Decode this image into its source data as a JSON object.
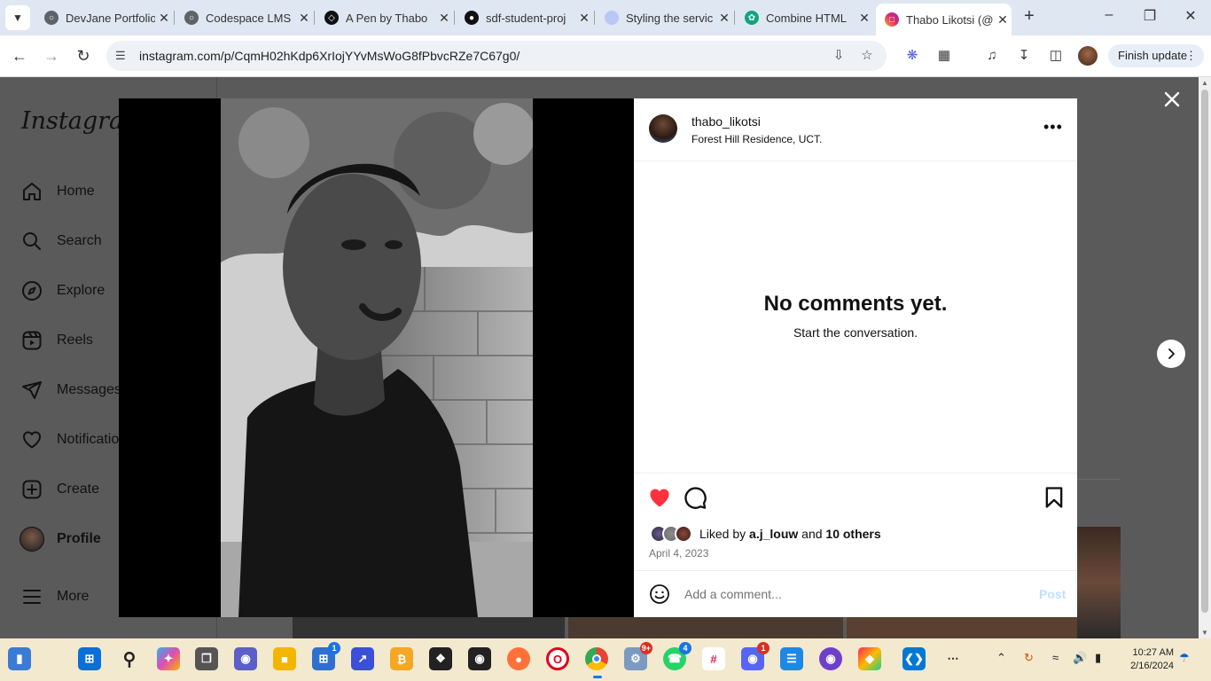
{
  "browser": {
    "tabs": [
      {
        "title": "DevJane Portfolio",
        "fav_color": "#5f6368",
        "active": false
      },
      {
        "title": "Codespace LMS",
        "fav_color": "#5f6368",
        "active": false
      },
      {
        "title": "A Pen by Thabo",
        "fav_color": "#111111",
        "active": false
      },
      {
        "title": "sdf-student-proj",
        "fav_color": "#111111",
        "active": false
      },
      {
        "title": "Styling the servic",
        "fav_color": "#b9c7f5",
        "active": false
      },
      {
        "title": "Combine HTML",
        "fav_color": "#10a37f",
        "active": false
      },
      {
        "title": "Thabo Likotsi (@",
        "fav_color": "#e1306c",
        "active": true
      }
    ],
    "url": "instagram.com/p/CqmH02hKdp6XrIojYYvMsWoG8fPbvcRZe7C67g0/",
    "finish_update_label": "Finish update",
    "new_tab_label": "+"
  },
  "instagram": {
    "logo_text": "Instagram",
    "nav": [
      {
        "label": "Home",
        "icon": "home-icon"
      },
      {
        "label": "Search",
        "icon": "search-icon"
      },
      {
        "label": "Explore",
        "icon": "explore-icon"
      },
      {
        "label": "Reels",
        "icon": "reels-icon"
      },
      {
        "label": "Messages",
        "icon": "messages-icon"
      },
      {
        "label": "Notifications",
        "icon": "heart-icon"
      },
      {
        "label": "Create",
        "icon": "create-icon"
      },
      {
        "label": "Profile",
        "icon": "avatar"
      },
      {
        "label": "More",
        "icon": "menu-icon"
      }
    ],
    "post": {
      "username": "thabo_likotsi",
      "location": "Forest Hill Residence, UCT.",
      "empty_title": "No comments yet.",
      "empty_subtitle": "Start the conversation.",
      "liked_prefix": "Liked by",
      "liked_user": "a.j_louw",
      "liked_and": "and",
      "liked_others": "10 others",
      "date": "April 4, 2023",
      "comment_placeholder": "Add a comment...",
      "post_label": "Post",
      "liked": true,
      "like_color": "#ff3040"
    }
  },
  "taskbar": {
    "badges": {
      "teams": "1",
      "chrome_ext": "9+",
      "whatsapp": "4",
      "discord": "1"
    },
    "time": "10:27 AM",
    "date": "2/16/2024"
  }
}
